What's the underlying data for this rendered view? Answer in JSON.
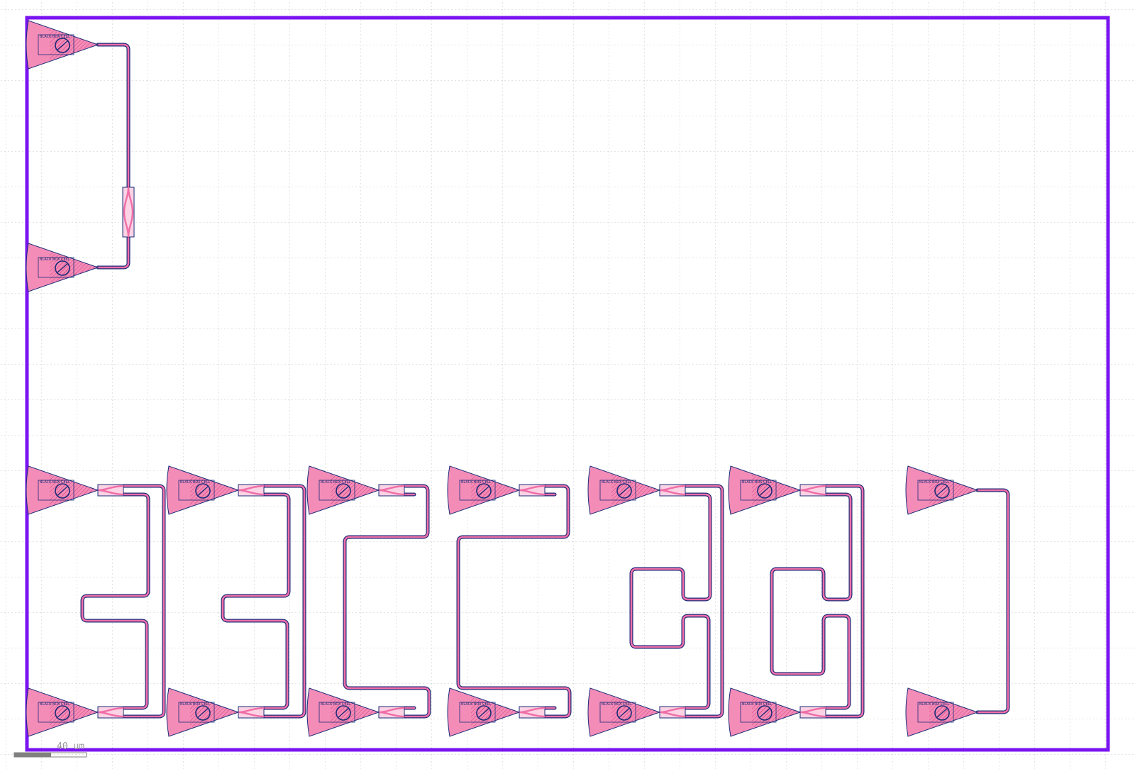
{
  "colors": {
    "background": "#ffffff",
    "grid": "#c8c8c8",
    "die_boundary": "#7a14f0",
    "waveguide_fill": "#f06ea8",
    "waveguide_edge": "#1b2c78",
    "coupler_fill": "#f48cb8",
    "coupler_edge": "#1b2c78",
    "splitter_fill": "#fbd3e4",
    "scale_bar": "#808080"
  },
  "grating_coupler": {
    "label": "BLACK BOX CELL",
    "icon": "grating-coupler-icon"
  },
  "scale": {
    "label": "40 um"
  }
}
